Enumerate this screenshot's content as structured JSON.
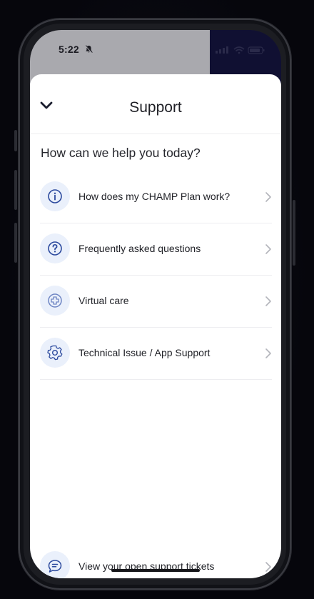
{
  "status_bar": {
    "time": "5:22",
    "bell_icon": "bell-slash-icon"
  },
  "sheet": {
    "title": "Support",
    "back_icon": "chevron-down-icon"
  },
  "help_heading": "How can we help you today?",
  "menu_items": [
    {
      "label": "How does my CHAMP Plan work?",
      "icon": "info-icon"
    },
    {
      "label": "Frequently asked questions",
      "icon": "question-icon"
    },
    {
      "label": "Virtual care",
      "icon": "medical-cross-icon"
    },
    {
      "label": "Technical Issue / App Support",
      "icon": "gear-icon"
    }
  ],
  "tickets": {
    "label": "View your open support tickets",
    "icon": "chat-ticket-icon"
  },
  "colors": {
    "accent": "#2c4a9e",
    "icon_bg": "#eaf0fb",
    "sheet_bg": "#ffffff",
    "frame_bg": "#05050b"
  }
}
